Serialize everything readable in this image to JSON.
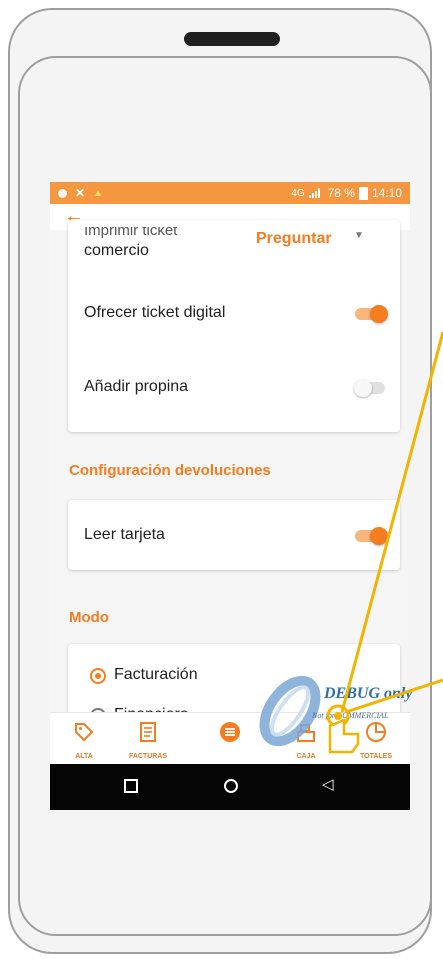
{
  "status_bar": {
    "network": "4G",
    "battery": "78 %",
    "time": "14:10"
  },
  "header": {
    "back_icon": "arrow-left-icon"
  },
  "settings": {
    "print_ticket_label_line1": "Imprimir ticket",
    "print_ticket_label_line2": "comercio",
    "print_ticket_value": "Preguntar",
    "digital_ticket_label": "Ofrecer ticket digital",
    "digital_ticket_on": true,
    "tip_label": "Añadir propina",
    "tip_on": false
  },
  "returns_section": {
    "title": "Configuración devoluciones",
    "read_card_label": "Leer tarjeta",
    "read_card_on": true
  },
  "mode_section": {
    "title": "Modo",
    "options": [
      "Facturación",
      "Financiero"
    ],
    "selected": "Facturación"
  },
  "bottom_nav": {
    "items": [
      {
        "label": "ALTA",
        "icon": "tag-icon"
      },
      {
        "label": "FACTURAS",
        "icon": "receipt-icon"
      },
      {
        "label": "",
        "icon": "menu-circle-icon"
      },
      {
        "label": "CAJA",
        "icon": "cash-register-icon"
      },
      {
        "label": "TOTALES",
        "icon": "pie-chart-icon"
      }
    ]
  },
  "watermark": {
    "title": "DEBUG only",
    "subtitle": "Not for COMMERCIAL"
  },
  "colors": {
    "accent": "#f57c1f",
    "statusbar": "#f59640",
    "pointer": "#f2b400"
  }
}
